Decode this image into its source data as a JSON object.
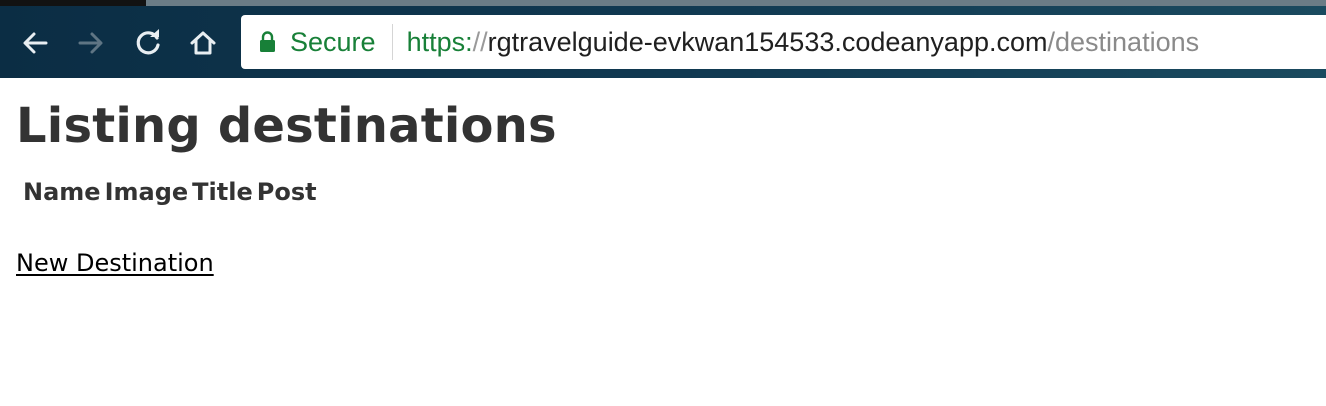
{
  "browser": {
    "security_label": "Secure",
    "url": {
      "scheme": "https:",
      "separator": "//",
      "host": "rgtravelguide-evkwan154533.codeanyapp.com",
      "path": "/destinations"
    },
    "icons": {
      "back": "arrow-left-icon",
      "forward": "arrow-right-icon",
      "reload": "reload-icon",
      "home": "home-icon",
      "lock": "lock-icon"
    },
    "colors": {
      "secure": "#188038",
      "toolbar": "#113a52"
    }
  },
  "page": {
    "title": "Listing destinations",
    "table": {
      "headers": [
        "Name",
        "Image",
        "Title",
        "Post"
      ],
      "rows": []
    },
    "new_link": "New Destination"
  }
}
